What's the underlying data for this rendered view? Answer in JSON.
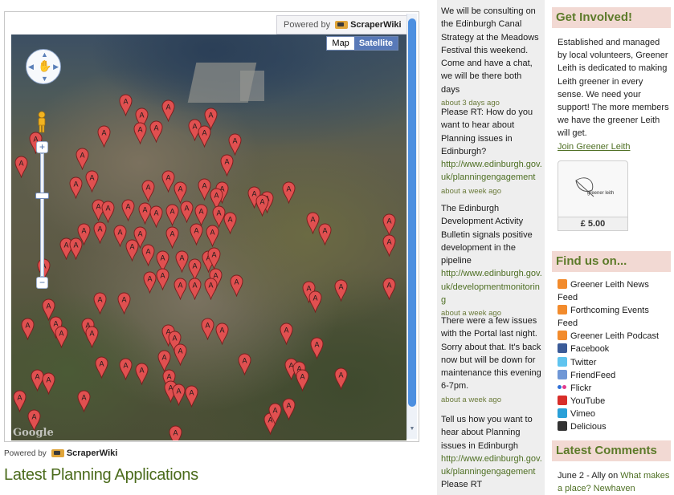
{
  "map": {
    "map_button": "Map",
    "satellite_button": "Satellite",
    "powered_by": "Powered by",
    "scraperwiki": "ScraperWiki",
    "google_logo": "Google",
    "pin_label": "A"
  },
  "powered_bottom": {
    "powered_by": "Powered by",
    "scraperwiki": "ScraperWiki"
  },
  "section_title": "Latest Planning Applications",
  "tweets": [
    {
      "text": "We will be consulting on the Edinburgh Canal Strategy at the Meadows Festival this weekend. Come and have a chat, we will be there both days",
      "link": "",
      "ago": "about 3 days ago"
    },
    {
      "text": "Please RT: How do you want to hear about Planning issues in Edinburgh?",
      "link": "http://www.edinburgh.gov.uk/planningengagement",
      "ago": "about a week ago"
    },
    {
      "text": "The Edinburgh Development Activity Bulletin signals positive development in the pipeline",
      "link": "http://www.edinburgh.gov.uk/developmentmonitoring",
      "ago": "about a week ago"
    },
    {
      "text": "There were a few issues with the Portal last night. Sorry about that. It's back now but will be down for maintenance this evening 6-7pm.",
      "link": "",
      "ago": "about a week ago"
    },
    {
      "text": "Tell us how you want to hear about Planning issues in Edinburgh",
      "link": "http://www.edinburgh.gov.uk/planningengagement",
      "after": "Please RT"
    }
  ],
  "sidebar": {
    "get_involved": {
      "title": "Get Involved!",
      "body": "Established and managed by local volunteers, Greener Leith is dedicated to making Leith greener in every sense. We need your support! The more members we have the greener Leith will get.",
      "join_link": "Join Greener Leith",
      "donate_logo_text": "greener leith",
      "donate_price": "£ 5.00"
    },
    "find_us": {
      "title": "Find us on...",
      "items": [
        {
          "label": "Greener Leith News Feed",
          "icon": "rss-icon"
        },
        {
          "label": "Forthcoming Events Feed",
          "icon": "rss-icon"
        },
        {
          "label": "Greener Leith Podcast",
          "icon": "rss-icon"
        },
        {
          "label": "Facebook",
          "icon": "facebook-icon"
        },
        {
          "label": "Twitter",
          "icon": "twitter-icon"
        },
        {
          "label": "FriendFeed",
          "icon": "friendfeed-icon"
        },
        {
          "label": "Flickr",
          "icon": "flickr-icon"
        },
        {
          "label": "YouTube",
          "icon": "youtube-icon"
        },
        {
          "label": "Vimeo",
          "icon": "vimeo-icon"
        },
        {
          "label": "Delicious",
          "icon": "delicious-icon"
        }
      ]
    },
    "latest_comments": {
      "title": "Latest Comments",
      "prefix": "June 2 - Ally on ",
      "link": "What makes a place? Newhaven"
    }
  },
  "colors": {
    "accent_green": "#4b6b1c",
    "link_green": "#4e6f23",
    "header_pink": "#f2d9d3",
    "pin_red": "#e05050",
    "satellite_blue": "#5879b8"
  }
}
